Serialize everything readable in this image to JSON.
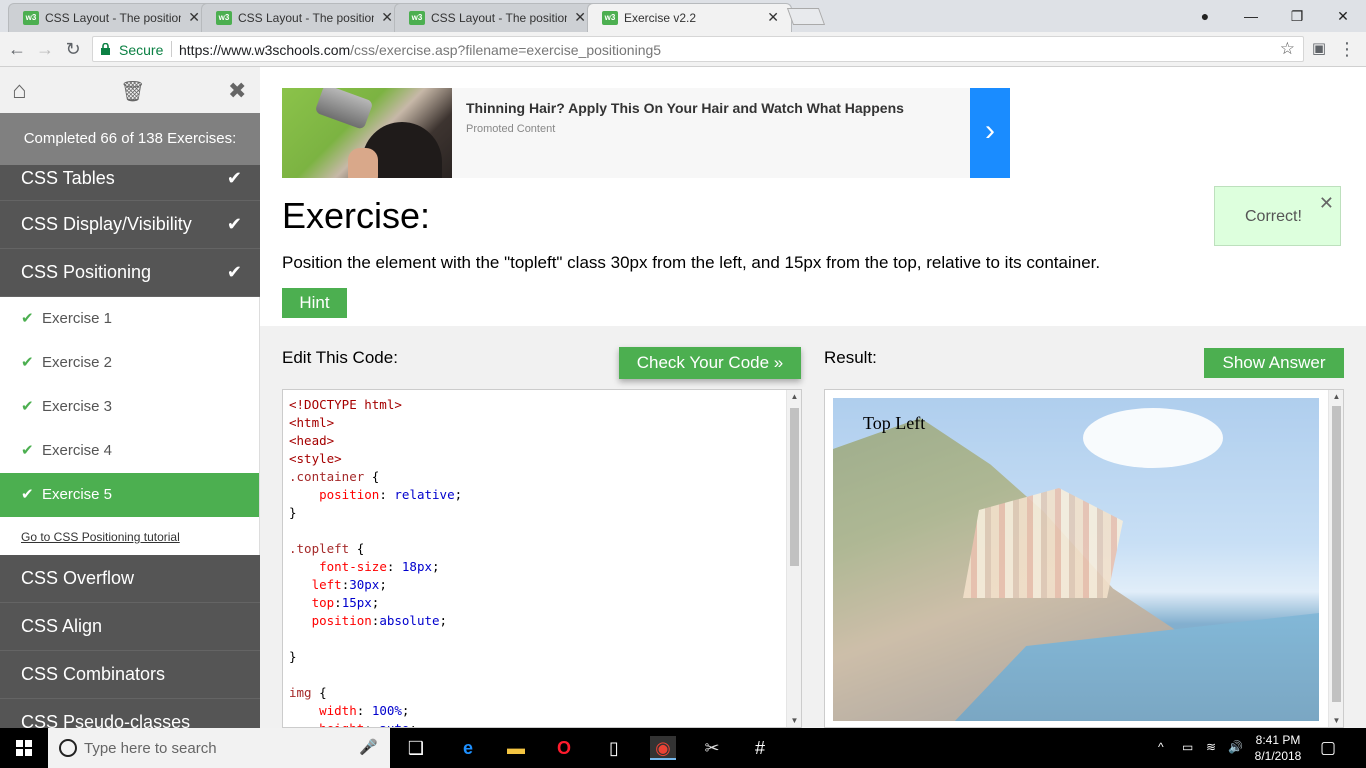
{
  "browser": {
    "tabs": [
      {
        "title": "CSS Layout - The position",
        "active": false
      },
      {
        "title": "CSS Layout - The position",
        "active": false
      },
      {
        "title": "CSS Layout - The position",
        "active": false
      },
      {
        "title": "Exercise v2.2",
        "active": true
      }
    ],
    "address": {
      "secure_label": "Secure",
      "url_host": "https://www.w3schools.com",
      "url_path": "/css/exercise.asp?filename=exercise_positioning5"
    }
  },
  "sidebar": {
    "completed": "Completed 66 of 138 Exercises:",
    "categories_before": [
      {
        "label": "CSS Tables",
        "done": true
      },
      {
        "label": "CSS Display/Visibility",
        "done": true
      },
      {
        "label": "CSS Positioning",
        "done": true
      }
    ],
    "exercises": [
      {
        "label": "Exercise 1",
        "done": true
      },
      {
        "label": "Exercise 2",
        "done": true
      },
      {
        "label": "Exercise 3",
        "done": true
      },
      {
        "label": "Exercise 4",
        "done": true
      },
      {
        "label": "Exercise 5",
        "done": true,
        "active": true
      }
    ],
    "tutorial_link": "Go to CSS Positioning tutorial",
    "categories_after": [
      {
        "label": "CSS Overflow"
      },
      {
        "label": "CSS Align"
      },
      {
        "label": "CSS Combinators"
      },
      {
        "label": "CSS Pseudo-classes"
      }
    ]
  },
  "ad": {
    "title": "Thinning Hair? Apply This On Your Hair and Watch What Happens",
    "subtitle": "Promoted Content"
  },
  "exercise": {
    "title": "Exercise:",
    "instruction": "Position the element with the \"topleft\" class 30px from the left, and 15px from the top, relative to its container.",
    "hint_label": "Hint",
    "correct_msg": "Correct!",
    "edit_label": "Edit This Code:",
    "check_label": "Check Your Code »",
    "result_label": "Result:",
    "answer_label": "Show Answer",
    "result_text": "Top Left"
  },
  "taskbar": {
    "search_placeholder": "Type here to search",
    "time": "8:41 PM",
    "date": "8/1/2018"
  },
  "colors": {
    "accent_green": "#4caf50",
    "sidebar_bg": "#555555",
    "ad_blue": "#1a8cff"
  }
}
